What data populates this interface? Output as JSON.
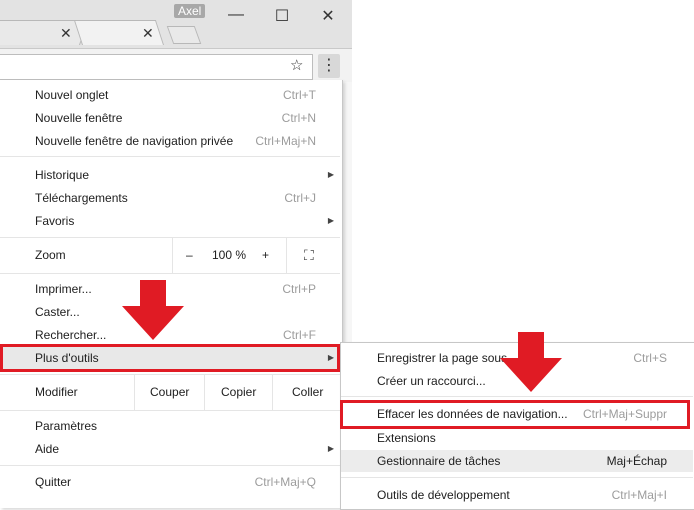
{
  "window": {
    "profile_name": "Axel",
    "close_tab_glyph": "✕",
    "minimize_glyph": "—",
    "maximize_glyph": "☐",
    "close_glyph": "✕",
    "star_glyph": "☆",
    "menu_glyph": "⋮"
  },
  "menu": {
    "new_tab": {
      "label": "Nouvel onglet",
      "shortcut": "Ctrl+T"
    },
    "new_window": {
      "label": "Nouvelle fenêtre",
      "shortcut": "Ctrl+N"
    },
    "new_private": {
      "label": "Nouvelle fenêtre de navigation privée",
      "shortcut": "Ctrl+Maj+N"
    },
    "history": {
      "label": "Historique"
    },
    "downloads": {
      "label": "Téléchargements",
      "shortcut": "Ctrl+J"
    },
    "bookmarks": {
      "label": "Favoris"
    },
    "zoom": {
      "label": "Zoom",
      "minus": "–",
      "value": "100 %",
      "plus": "+",
      "fullscreen": "⛶"
    },
    "print": {
      "label": "Imprimer...",
      "shortcut": "Ctrl+P"
    },
    "cast": {
      "label": "Caster..."
    },
    "find": {
      "label": "Rechercher...",
      "shortcut": "Ctrl+F"
    },
    "more_tools": {
      "label": "Plus d'outils"
    },
    "edit": {
      "label": "Modifier",
      "cut": "Couper",
      "copy": "Copier",
      "paste": "Coller"
    },
    "settings": {
      "label": "Paramètres"
    },
    "help": {
      "label": "Aide"
    },
    "quit": {
      "label": "Quitter",
      "shortcut": "Ctrl+Maj+Q"
    },
    "submenu_arrow": "▶"
  },
  "submenu": {
    "save_page": {
      "label": "Enregistrer la page sous...",
      "shortcut": "Ctrl+S"
    },
    "create_shortcut": {
      "label": "Créer un raccourci..."
    },
    "clear_data": {
      "label": "Effacer les données de navigation...",
      "shortcut": "Ctrl+Maj+Suppr"
    },
    "extensions": {
      "label": "Extensions"
    },
    "task_manager": {
      "label": "Gestionnaire de tâches",
      "shortcut": "Maj+Échap"
    },
    "dev_tools": {
      "label": "Outils de développement",
      "shortcut": "Ctrl+Maj+I"
    }
  },
  "colors": {
    "highlight": "#e01b24",
    "hover": "#e8e8e8"
  }
}
